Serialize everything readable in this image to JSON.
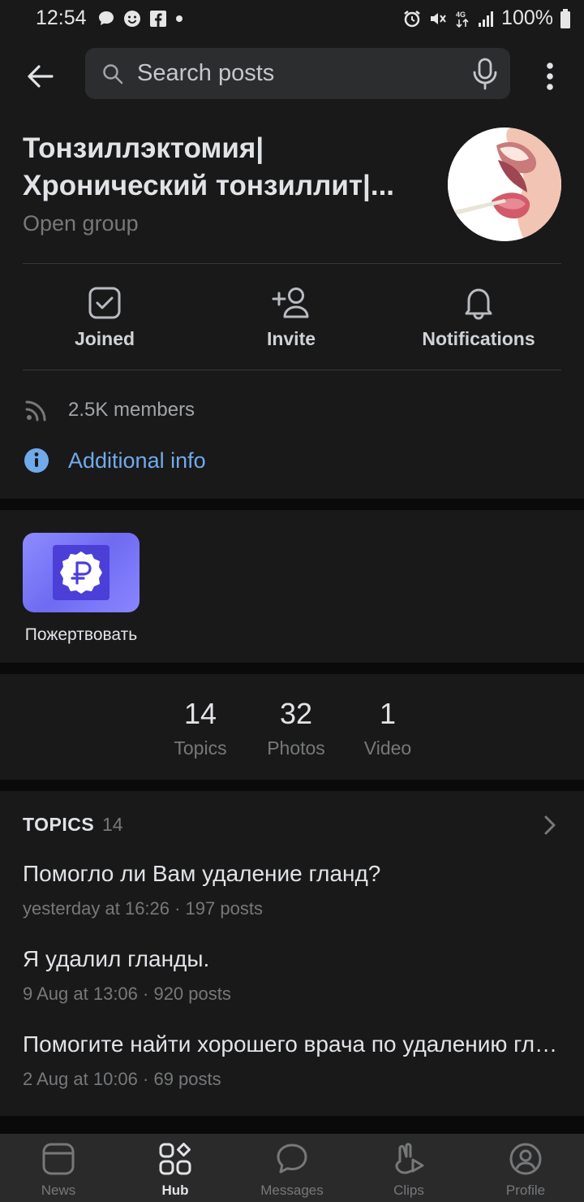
{
  "status_bar": {
    "time": "12:54",
    "battery": "100%"
  },
  "search": {
    "placeholder": "Search posts"
  },
  "group": {
    "title_line1": "Тонзиллэктомия|",
    "title_line2": "Хронический тонзиллит|...",
    "type": "Open group"
  },
  "actions": [
    {
      "label": "Joined",
      "icon": "check-square-icon"
    },
    {
      "label": "Invite",
      "icon": "add-user-icon"
    },
    {
      "label": "Notifications",
      "icon": "bell-icon"
    }
  ],
  "members": {
    "text": "2.5K members",
    "icon": "rss-icon"
  },
  "additional_info": {
    "text": "Additional info",
    "icon": "info-icon"
  },
  "app": {
    "label": "Пожертвовать",
    "icon": "ruble-badge-icon"
  },
  "counters": [
    {
      "value": "14",
      "caption": "Topics"
    },
    {
      "value": "32",
      "caption": "Photos"
    },
    {
      "value": "1",
      "caption": "Video"
    }
  ],
  "topics": {
    "heading": "TOPICS",
    "count": "14",
    "items": [
      {
        "title": "Помогло ли Вам удаление гланд?",
        "meta": "yesterday at 16:26 · 197 posts"
      },
      {
        "title": "Я удалил гланды.",
        "meta": "9 Aug at 13:06 · 920 posts"
      },
      {
        "title": "Помогите найти хорошего врача по удалению гланд",
        "meta": "2 Aug at 10:06 · 69 posts"
      }
    ]
  },
  "tabbar": [
    {
      "label": "News",
      "icon": "news-icon"
    },
    {
      "label": "Hub",
      "icon": "hub-icon"
    },
    {
      "label": "Messages",
      "icon": "messages-icon"
    },
    {
      "label": "Clips",
      "icon": "clips-icon"
    },
    {
      "label": "Profile",
      "icon": "profile-icon"
    }
  ],
  "colors": {
    "accent": "#71aaeb",
    "background": "#19191a",
    "separator": "#0a0a0a",
    "tabbar": "#2a2a2b"
  }
}
